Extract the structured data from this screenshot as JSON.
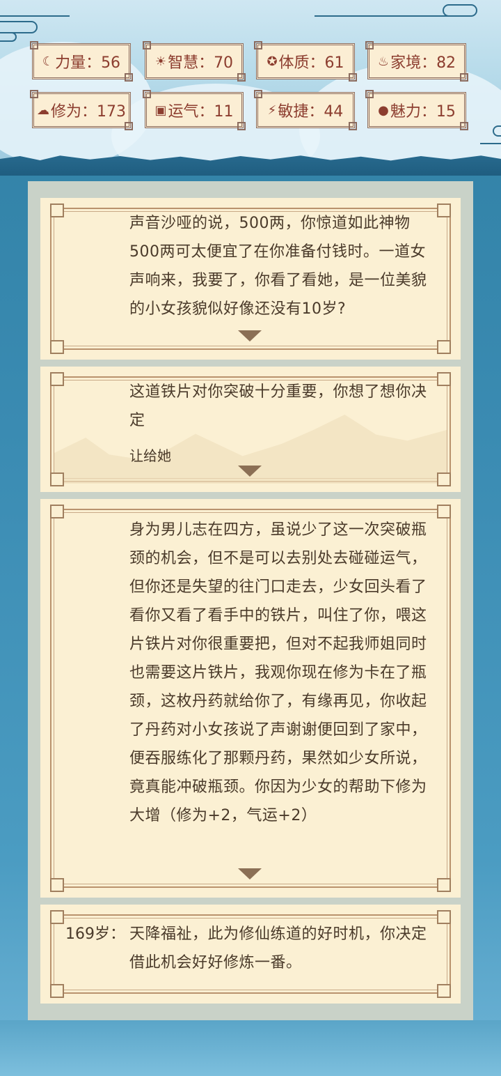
{
  "stats": [
    {
      "icon": "strength-icon",
      "glyph": "☾",
      "label": "力量：56"
    },
    {
      "icon": "wisdom-icon",
      "glyph": "☀",
      "label": "智慧：70"
    },
    {
      "icon": "constitution-icon",
      "glyph": "✪",
      "label": "体质：61"
    },
    {
      "icon": "family-icon",
      "glyph": "♨",
      "label": "家境：82"
    },
    {
      "icon": "cultivation-icon",
      "glyph": "☁",
      "label": "修为：173"
    },
    {
      "icon": "luck-icon",
      "glyph": "▣",
      "label": "运气：11"
    },
    {
      "icon": "agility-icon",
      "glyph": "⚡",
      "label": "敏捷：44"
    },
    {
      "icon": "charm-icon",
      "glyph": "●",
      "label": "魅力：15"
    }
  ],
  "story": {
    "card1": "声音沙哑的说，500两，你惊道如此神物500两可太便宜了在你准备付钱时。一道女声响来，我要了，你看了看她，是一位美貌的小女孩貌似好像还没有10岁?",
    "card2": "这道铁片对你突破十分重要，你想了想你决定",
    "card2_choice": "让给她",
    "card3": "身为男儿志在四方，虽说少了这一次突破瓶颈的机会，但不是可以去别处去碰碰运气，但你还是失望的往门口走去，少女回头看了看你又看了看手中的铁片，叫住了你，喂这片铁片对你很重要把，但对不起我师姐同时也需要这片铁片，我观你现在修为卡在了瓶颈，这枚丹药就给你了，有缘再见，你收起了丹药对小女孩说了声谢谢便回到了家中，便吞服练化了那颗丹药，果然如少女所说，竟真能冲破瓶颈。你因为少女的帮助下修为大增（修为+2，气运+2）",
    "card4_age": "169岁：",
    "card4": "天降福祉，此为修仙练道的好时机，你决定借此机会好好修炼一番。"
  }
}
